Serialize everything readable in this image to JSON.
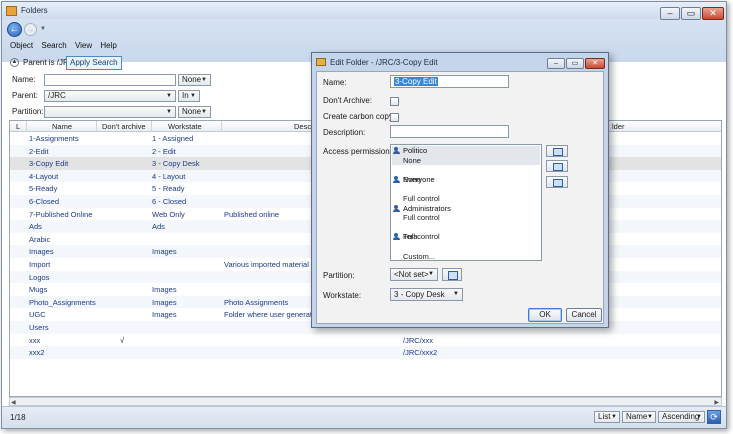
{
  "window": {
    "title": "Folders"
  },
  "menu": [
    "Object",
    "Search",
    "View",
    "Help"
  ],
  "parent_prefix": "Parent is /JRC",
  "apply_search": "Apply Search",
  "search_form": {
    "name_label": "Name:",
    "name_value": "",
    "name_mode": "None",
    "parent_label": "Parent:",
    "parent_value": "/JRC",
    "parent_mode": "In",
    "partition_label": "Partition:",
    "partition_value": "",
    "partition_mode": "None"
  },
  "grid": {
    "columns": {
      "l": "L",
      "name": "Name",
      "dont_archive": "Don't archive",
      "workstate": "Workstate",
      "description": "Descri",
      "folder": "lder"
    },
    "rows": [
      {
        "name": "1-Assignments",
        "check": "",
        "workstate": "1 - Assigned",
        "desc": "",
        "path": ""
      },
      {
        "name": "2-Edit",
        "check": "",
        "workstate": "2 - Edit",
        "desc": "",
        "path": ""
      },
      {
        "name": "3-Copy Edit",
        "check": "",
        "workstate": "3 - Copy Desk",
        "desc": "",
        "path": ""
      },
      {
        "name": "4-Layout",
        "check": "",
        "workstate": "4 - Layout",
        "desc": "",
        "path": ""
      },
      {
        "name": "5-Ready",
        "check": "",
        "workstate": "5 - Ready",
        "desc": "",
        "path": ""
      },
      {
        "name": "6-Closed",
        "check": "",
        "workstate": "6 - Closed",
        "desc": "",
        "path": ""
      },
      {
        "name": "7-Published Online",
        "check": "",
        "workstate": "Web Only",
        "desc": "Published online",
        "path": ""
      },
      {
        "name": "Ads",
        "check": "",
        "workstate": "Ads",
        "desc": "",
        "path": ""
      },
      {
        "name": "Arabic",
        "check": "",
        "workstate": "",
        "desc": "",
        "path": ""
      },
      {
        "name": "Images",
        "check": "",
        "workstate": "Images",
        "desc": "",
        "path": ""
      },
      {
        "name": "Import",
        "check": "",
        "workstate": "",
        "desc": "Various imported material",
        "path": ""
      },
      {
        "name": "Logos",
        "check": "",
        "workstate": "",
        "desc": "",
        "path": ""
      },
      {
        "name": "Mugs",
        "check": "",
        "workstate": "Images",
        "desc": "",
        "path": ""
      },
      {
        "name": "Photo_Assignments",
        "check": "",
        "workstate": "Images",
        "desc": "Photo Assignments",
        "path": ""
      },
      {
        "name": "UGC",
        "check": "",
        "workstate": "Images",
        "desc": "Folder where user generated",
        "path": ""
      },
      {
        "name": "Users",
        "check": "",
        "workstate": "",
        "desc": "",
        "path": ""
      },
      {
        "name": "xxx",
        "check": "√",
        "workstate": "",
        "desc": "",
        "path": "/JRC/xxx"
      },
      {
        "name": "xxx2",
        "check": "",
        "workstate": "",
        "desc": "",
        "path": "/JRC/xxx2"
      }
    ]
  },
  "status": {
    "count": "1/18",
    "view": "List",
    "sort_field": "Name",
    "sort_order": "Ascending"
  },
  "dialog": {
    "title": "Edit Folder - /JRC/3-Copy Edit",
    "name_label": "Name:",
    "name_value": "3-Copy Edit",
    "dont_archive_label": "Don't Archive:",
    "carbon_copy_label": "Create carbon copy:",
    "description_label": "Description:",
    "description_value": "",
    "permissions_label": "Access permissions:",
    "permissions": [
      {
        "user": "Politico",
        "level": "None"
      },
      {
        "user": "Everyone",
        "level": "None"
      },
      {
        "user": "Administrators",
        "level": "Full control"
      },
      {
        "user": "Tera",
        "level": "Full control"
      },
      {
        "user": "Editors",
        "level": "Full control"
      },
      {
        "user": "Reporters",
        "level": "Custom..."
      }
    ],
    "partition_label": "Partition:",
    "partition_value": "<Not set>",
    "workstate_label": "Workstate:",
    "workstate_value": "3 - Copy Desk",
    "ok": "OK",
    "cancel": "Cancel"
  },
  "colors": {
    "link_text": "#1b3a8c",
    "selection": "#3a86d6",
    "accent": "#4a8bc8"
  }
}
